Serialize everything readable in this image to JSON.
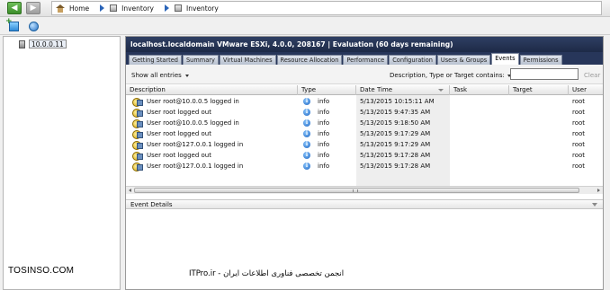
{
  "breadcrumb": {
    "home": "Home",
    "items": [
      "Inventory",
      "Inventory"
    ]
  },
  "tree": {
    "host": "10.0.0.11"
  },
  "host_header": "localhost.localdomain VMware ESXi, 4.0.0, 208167 | Evaluation (60 days remaining)",
  "tabs": [
    "Getting Started",
    "Summary",
    "Virtual Machines",
    "Resource Allocation",
    "Performance",
    "Configuration",
    "Users & Groups",
    "Events",
    "Permissions"
  ],
  "active_tab": "Events",
  "filter": {
    "show_label": "Show all entries",
    "label": "Description, Type or Target contains:",
    "value": "",
    "clear": "Clear"
  },
  "columns": [
    "Description",
    "Type",
    "Date Time",
    "Task",
    "Target",
    "User"
  ],
  "events": [
    {
      "description": "User root@10.0.0.5 logged in",
      "type": "info",
      "datetime": "5/13/2015 10:15:11 AM",
      "task": "",
      "target": "",
      "user": "root"
    },
    {
      "description": "User root logged out",
      "type": "info",
      "datetime": "5/13/2015 9:47:35 AM",
      "task": "",
      "target": "",
      "user": "root"
    },
    {
      "description": "User root@10.0.0.5 logged in",
      "type": "info",
      "datetime": "5/13/2015 9:18:50 AM",
      "task": "",
      "target": "",
      "user": "root"
    },
    {
      "description": "User root logged out",
      "type": "info",
      "datetime": "5/13/2015 9:17:29 AM",
      "task": "",
      "target": "",
      "user": "root"
    },
    {
      "description": "User root@127.0.0.1 logged in",
      "type": "info",
      "datetime": "5/13/2015 9:17:29 AM",
      "task": "",
      "target": "",
      "user": "root"
    },
    {
      "description": "User root logged out",
      "type": "info",
      "datetime": "5/13/2015 9:17:28 AM",
      "task": "",
      "target": "",
      "user": "root"
    },
    {
      "description": "User root@127.0.0.1 logged in",
      "type": "info",
      "datetime": "5/13/2015 9:17:28 AM",
      "task": "",
      "target": "",
      "user": "root"
    }
  ],
  "event_details_title": "Event Details",
  "watermark": {
    "left": "TOSINSO.COM",
    "right": "ITPro.ir - انجمن تخصصی فناوری اطلاعات ایران"
  },
  "icons": {
    "back": "back-arrow-icon",
    "forward": "forward-arrow-icon",
    "home": "home-icon",
    "inventory": "inventory-icon",
    "add": "add-host-icon",
    "refresh": "refresh-icon",
    "event": "user-event-icon",
    "info": "info-icon"
  },
  "colors": {
    "header_bg": "#1d2a47",
    "info_blue": "#1c63c0",
    "back_green": "#3c8d2a"
  }
}
